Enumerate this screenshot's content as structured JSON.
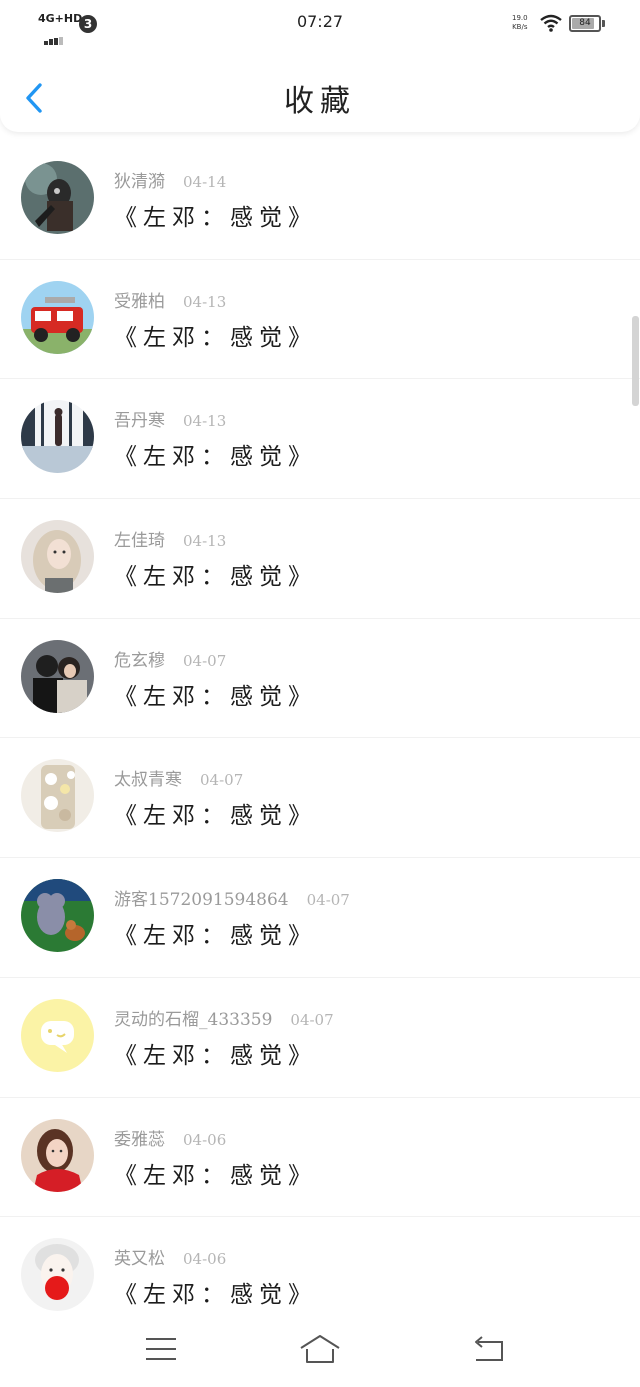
{
  "status_bar": {
    "network": "4G+HD",
    "notification_count": "3",
    "time": "07:27",
    "speed_value": "19.0",
    "speed_unit": "KB/s",
    "battery": "84",
    "battery_level": 0.84
  },
  "header": {
    "title": "收藏",
    "back_icon": "chevron-left-icon",
    "accent_color": "#2196f3"
  },
  "favorites": [
    {
      "name": "狄清漪",
      "date": "04-14",
      "text": "《左邓：感觉》",
      "avatar": "dark-warrior"
    },
    {
      "name": "受雅柏",
      "date": "04-13",
      "text": "《左邓：感觉》",
      "avatar": "red-fire-truck"
    },
    {
      "name": "吾丹寒",
      "date": "04-13",
      "text": "《左邓：感觉》",
      "avatar": "person-window"
    },
    {
      "name": "左佳琦",
      "date": "04-13",
      "text": "《左邓：感觉》",
      "avatar": "blonde-girl"
    },
    {
      "name": "危玄穆",
      "date": "04-07",
      "text": "《左邓：感觉》",
      "avatar": "couple"
    },
    {
      "name": "太叔青寒",
      "date": "04-07",
      "text": "《左邓：感觉》",
      "avatar": "jeweled-case"
    },
    {
      "name": "游客1572091594864",
      "date": "04-07",
      "text": "《左邓：感觉》",
      "avatar": "cartoon-cat"
    },
    {
      "name": "灵动的石榴_433359",
      "date": "04-07",
      "text": "《左邓：感觉》",
      "avatar": "yellow-chat"
    },
    {
      "name": "委雅蕊",
      "date": "04-06",
      "text": "《左邓：感觉》",
      "avatar": "girl-red-scarf"
    },
    {
      "name": "英又松",
      "date": "04-06",
      "text": "《左邓：感觉》",
      "avatar": "white-hair-person"
    }
  ],
  "nav_bar": {
    "menu_icon": "menu-icon",
    "home_icon": "home-icon",
    "back_icon": "back-icon"
  }
}
